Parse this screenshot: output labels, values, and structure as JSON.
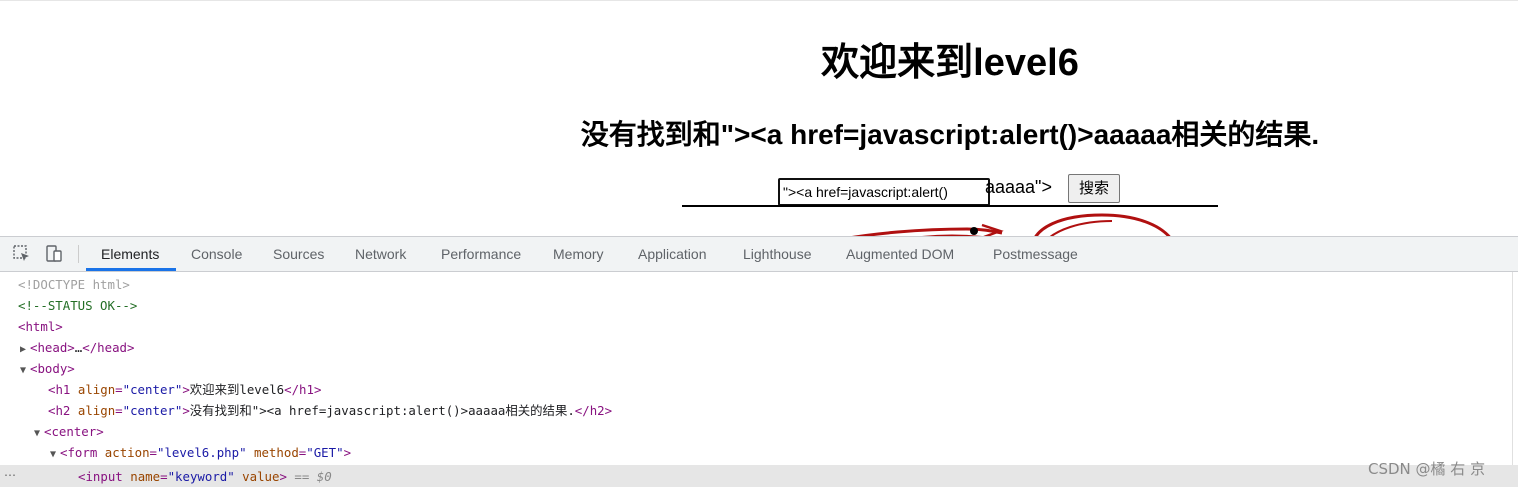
{
  "page": {
    "h1": "欢迎来到level6",
    "h2": "没有找到和\"><a href=javascript:alert()>aaaaa相关的结果.",
    "input_value": "\"><a href=javascript:alert()",
    "input_after_text": "aaaaa\">",
    "search_button": "搜索"
  },
  "devtools": {
    "tabs": [
      "Elements",
      "Console",
      "Sources",
      "Network",
      "Performance",
      "Memory",
      "Application",
      "Lighthouse",
      "Augmented DOM",
      "Postmessage"
    ],
    "active_tab": "Elements",
    "dom": {
      "doctype": "<!DOCTYPE html>",
      "comment": "<!--STATUS OK-->",
      "html_open": "<html>",
      "head": {
        "open": "<head>",
        "ellipsis": "…",
        "close": "</head>"
      },
      "body_open": "<body>",
      "h1": {
        "tag": "h1",
        "attr": "align",
        "val": "\"center\"",
        "text": "欢迎来到level6",
        "close": "</h1>"
      },
      "h2": {
        "tag": "h2",
        "attr": "align",
        "val": "\"center\"",
        "text": "没有找到和\"><a href=javascript:alert()>aaaaa相关的结果.",
        "close": "</h2>"
      },
      "center_open": "<center>",
      "form": {
        "tag": "form",
        "attr1": "action",
        "val1": "\"level6.php\"",
        "attr2": "method",
        "val2": "\"GET\""
      },
      "input": {
        "tag": "input",
        "attr1": "name",
        "val1": "\"keyword\"",
        "attr2": "value",
        "suffix": "== $0"
      }
    },
    "more": "⋯"
  },
  "watermark": "CSDN @橘 右 京"
}
